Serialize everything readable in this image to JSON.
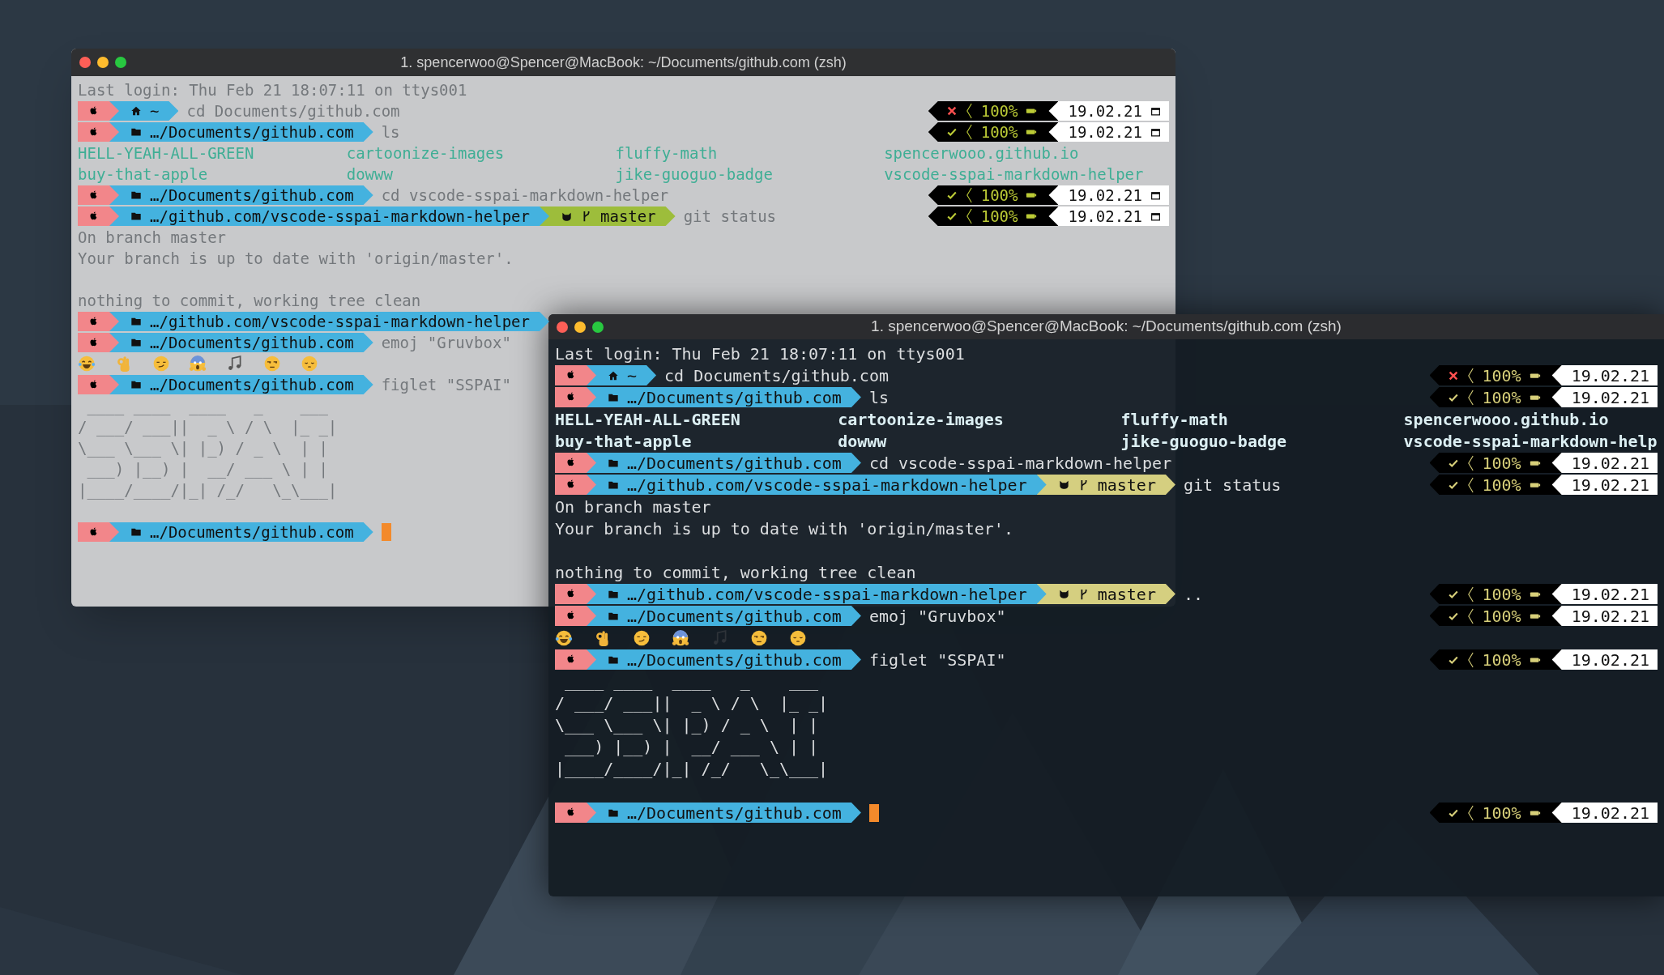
{
  "windows": [
    {
      "dark": false,
      "title": "1. spencerwoo@Spencer@MacBook: ~/Documents/github.com (zsh)",
      "calendar_icons": true,
      "lines": [
        {
          "kind": "text",
          "text": "Last login: Thu Feb 21 18:07:11 on ttys001"
        },
        {
          "kind": "prompt",
          "home": true,
          "path": "~",
          "command": "cd Documents/github.com",
          "status": {
            "ok": false,
            "battery": "100%",
            "date": "19.02.21"
          }
        },
        {
          "kind": "prompt",
          "home": false,
          "path": "…/Documents/github.com",
          "command": "ls",
          "status": {
            "ok": true,
            "battery": "100%",
            "date": "19.02.21"
          }
        },
        {
          "kind": "listing",
          "items": [
            "HELL-YEAH-ALL-GREEN",
            "cartoonize-images",
            "fluffy-math",
            "spencerwooo.github.io"
          ]
        },
        {
          "kind": "listing",
          "items": [
            "buy-that-apple",
            "dowww",
            "jike-guoguo-badge",
            "vscode-sspai-markdown-helper"
          ]
        },
        {
          "kind": "prompt",
          "home": false,
          "path": "…/Documents/github.com",
          "command": "cd vscode-sspai-markdown-helper",
          "status": {
            "ok": true,
            "battery": "100%",
            "date": "19.02.21"
          }
        },
        {
          "kind": "prompt",
          "home": false,
          "path": "…/github.com/vscode-sspai-markdown-helper",
          "branch": "master",
          "command": "git status",
          "status": {
            "ok": true,
            "battery": "100%",
            "date": "19.02.21"
          }
        },
        {
          "kind": "text",
          "text": "On branch master"
        },
        {
          "kind": "text",
          "text": "Your branch is up to date with 'origin/master'."
        },
        {
          "kind": "blank"
        },
        {
          "kind": "text",
          "text": "nothing to commit, working tree clean"
        },
        {
          "kind": "prompt",
          "home": false,
          "path": "…/github.com/vscode-sspai-markdown-helper"
        },
        {
          "kind": "prompt",
          "home": false,
          "path": "…/Documents/github.com",
          "command": "emoj \"Gruvbox\""
        },
        {
          "kind": "emoji"
        },
        {
          "kind": "prompt",
          "home": false,
          "path": "…/Documents/github.com",
          "command": "figlet \"SSPAI\""
        },
        {
          "kind": "figlet",
          "lines": [
            " ____ ____  ____   _    ___",
            "/ ___/ ___||  _ \\ / \\  |_ _|",
            "\\___ \\___ \\| |_) / _ \\  | |",
            " ___) |__) |  __/ ___ \\ | |",
            "|____/____/|_| /_/   \\_\\___|"
          ]
        },
        {
          "kind": "blank"
        },
        {
          "kind": "prompt",
          "home": false,
          "path": "…/Documents/github.com",
          "cursor": true
        }
      ]
    },
    {
      "dark": true,
      "title": "1. spencerwoo@Spencer@MacBook: ~/Documents/github.com (zsh)",
      "calendar_icons": false,
      "lines": [
        {
          "kind": "text",
          "text": "Last login: Thu Feb 21 18:07:11 on ttys001"
        },
        {
          "kind": "prompt",
          "home": true,
          "path": "~",
          "command": "cd Documents/github.com",
          "status": {
            "ok": false,
            "battery": "100%",
            "date": "19.02.21"
          }
        },
        {
          "kind": "prompt",
          "home": false,
          "path": "…/Documents/github.com",
          "command": "ls",
          "status": {
            "ok": true,
            "battery": "100%",
            "date": "19.02.21"
          }
        },
        {
          "kind": "listing",
          "items": [
            "HELL-YEAH-ALL-GREEN",
            "cartoonize-images",
            "fluffy-math",
            "spencerwooo.github.io"
          ]
        },
        {
          "kind": "listing",
          "items": [
            "buy-that-apple",
            "dowww",
            "jike-guoguo-badge",
            "vscode-sspai-markdown-help"
          ]
        },
        {
          "kind": "prompt",
          "home": false,
          "path": "…/Documents/github.com",
          "command": "cd vscode-sspai-markdown-helper",
          "status": {
            "ok": true,
            "battery": "100%",
            "date": "19.02.21"
          }
        },
        {
          "kind": "prompt",
          "home": false,
          "path": "…/github.com/vscode-sspai-markdown-helper",
          "branch": "master",
          "command": "git status",
          "status": {
            "ok": true,
            "battery": "100%",
            "date": "19.02.21"
          }
        },
        {
          "kind": "text",
          "text": "On branch master"
        },
        {
          "kind": "text",
          "text": "Your branch is up to date with 'origin/master'."
        },
        {
          "kind": "blank"
        },
        {
          "kind": "text",
          "text": "nothing to commit, working tree clean"
        },
        {
          "kind": "prompt",
          "home": false,
          "path": "…/github.com/vscode-sspai-markdown-helper",
          "branch": "master",
          "command": "..",
          "status": {
            "ok": true,
            "battery": "100%",
            "date": "19.02.21"
          }
        },
        {
          "kind": "prompt",
          "home": false,
          "path": "…/Documents/github.com",
          "command": "emoj \"Gruvbox\"",
          "status": {
            "ok": true,
            "battery": "100%",
            "date": "19.02.21"
          }
        },
        {
          "kind": "emoji"
        },
        {
          "kind": "prompt",
          "home": false,
          "path": "…/Documents/github.com",
          "command": "figlet \"SSPAI\"",
          "status": {
            "ok": true,
            "battery": "100%",
            "date": "19.02.21"
          }
        },
        {
          "kind": "figlet",
          "lines": [
            " ____ ____  ____   _    ___",
            "/ ___/ ___||  _ \\ / \\  |_ _|",
            "\\___ \\___ \\| |_) / _ \\  | |",
            " ___) |__) |  __/ ___ \\ | |",
            "|____/____/|_| /_/   \\_\\___|"
          ]
        },
        {
          "kind": "blank"
        },
        {
          "kind": "prompt",
          "home": false,
          "path": "…/Documents/github.com",
          "cursor": true,
          "status": {
            "ok": true,
            "battery": "100%",
            "date": "19.02.21"
          }
        }
      ]
    }
  ]
}
